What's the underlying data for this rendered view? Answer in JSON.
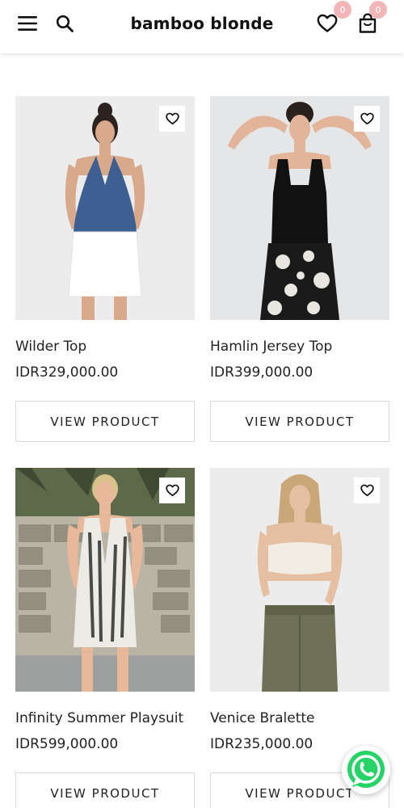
{
  "header": {
    "brand": "bamboo blonde",
    "wishlist_count": "0",
    "cart_count": "0"
  },
  "products": [
    {
      "name": "Wilder Top",
      "price": "IDR329,000.00",
      "button": "VIEW PRODUCT"
    },
    {
      "name": "Hamlin Jersey Top",
      "price": "IDR399,000.00",
      "button": "VIEW PRODUCT"
    },
    {
      "name": "Infinity Summer Playsuit",
      "price": "IDR599,000.00",
      "button": "VIEW PRODUCT"
    },
    {
      "name": "Venice Bralette",
      "price": "IDR235,000.00",
      "button": "VIEW PRODUCT"
    }
  ],
  "icons": {
    "menu": "hamburger-menu-icon",
    "search": "search-icon",
    "wishlist": "heart-icon",
    "cart": "shopping-bag-icon",
    "favorite": "heart-outline-icon",
    "chat": "whatsapp-icon"
  },
  "colors": {
    "badge": "#f3b6b8",
    "whatsapp": "#25d366",
    "button_border": "#d8d8d8"
  }
}
